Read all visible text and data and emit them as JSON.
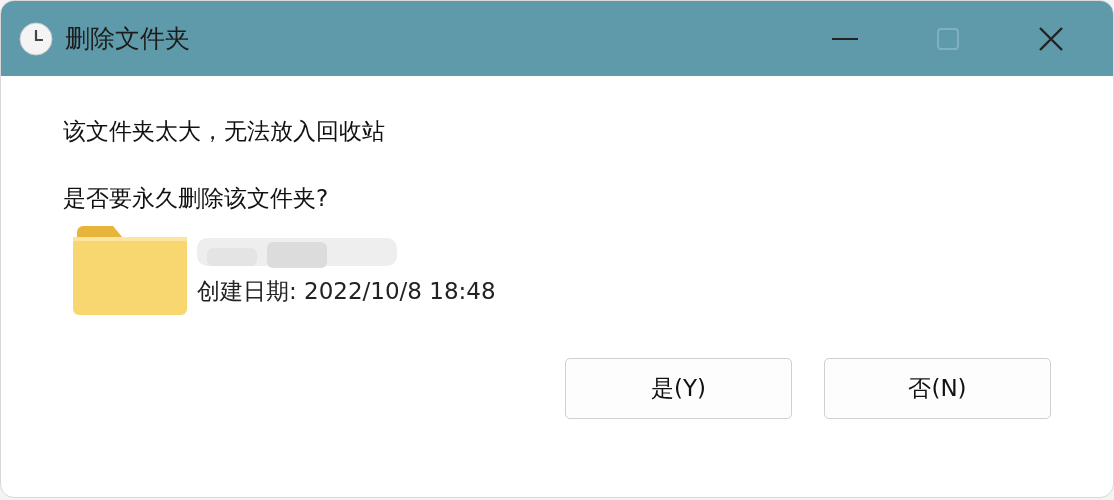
{
  "window": {
    "title": "删除文件夹"
  },
  "message": "该文件夹太大，无法放入回收站",
  "question": "是否要永久删除该文件夹?",
  "item": {
    "created": "创建日期: 2022/10/8 18:48"
  },
  "buttons": [
    {
      "label": "是(Y)"
    },
    {
      "label": "否(N)"
    }
  ]
}
